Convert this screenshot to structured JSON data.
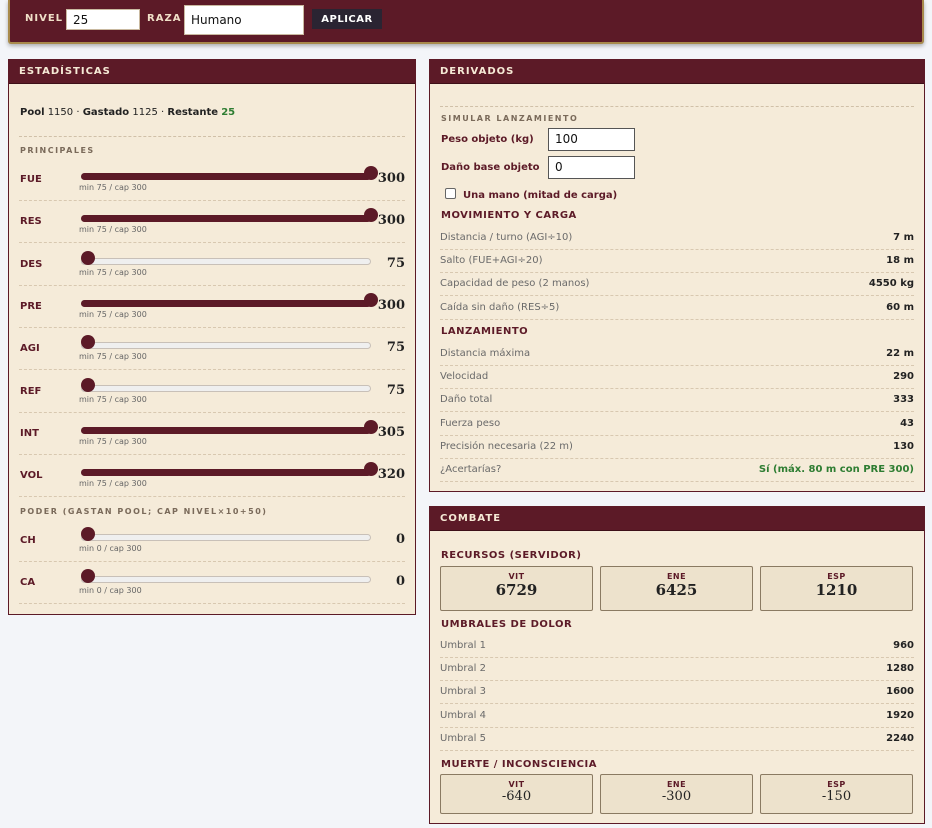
{
  "topbar": {
    "level_label": "NIVEL",
    "level_value": "25",
    "race_label": "RAZA",
    "race_value": "Humano",
    "apply_label": "APLICAR"
  },
  "stats": {
    "title": "ESTADÍSTICAS",
    "pool_label": "Pool",
    "pool_value": "1150",
    "spent_label": "Gastado",
    "spent_value": "1125",
    "remaining_label": "Restante",
    "remaining_value": "25",
    "principal_title": "PRINCIPALES",
    "principal": [
      {
        "code": "FUE",
        "range": "min 75 / cap 300",
        "value": "300",
        "level": 1.0
      },
      {
        "code": "RES",
        "range": "min 75 / cap 300",
        "value": "300",
        "level": 1.0
      },
      {
        "code": "DES",
        "range": "min 75 / cap 300",
        "value": "75",
        "level": 0.0
      },
      {
        "code": "PRE",
        "range": "min 75 / cap 300",
        "value": "300",
        "level": 1.0
      },
      {
        "code": "AGI",
        "range": "min 75 / cap 300",
        "value": "75",
        "level": 0.0
      },
      {
        "code": "REF",
        "range": "min 75 / cap 300",
        "value": "75",
        "level": 0.0
      },
      {
        "code": "INT",
        "range": "min 75 / cap 300",
        "value": "305",
        "level": 1.0
      },
      {
        "code": "VOL",
        "range": "min 75 / cap 300",
        "value": "320",
        "level": 1.0
      }
    ],
    "power_title": "PODER (GASTAN POOL; CAP NIVEL×10+50)",
    "power": [
      {
        "code": "CH",
        "range": "min 0 / cap 300",
        "value": "0",
        "level": 0.0
      },
      {
        "code": "CA",
        "range": "min 0 / cap 300",
        "value": "0",
        "level": 0.0
      }
    ]
  },
  "derived": {
    "title": "DERIVADOS",
    "simulate_title": "SIMULAR LANZAMIENTO",
    "weight_label": "Peso objeto (kg)",
    "weight_value": "100",
    "damage_label": "Daño base objeto",
    "damage_value": "0",
    "one_hand_label": "Una mano (mitad de carga)",
    "movement_title": "MOVIMIENTO Y CARGA",
    "movement": [
      {
        "k": "Distancia / turno (AGI÷10)",
        "v": "7 m"
      },
      {
        "k": "Salto (FUE+AGI÷20)",
        "v": "18 m"
      },
      {
        "k": "Capacidad de peso (2 manos)",
        "v": "4550 kg"
      },
      {
        "k": "Caída sin daño (RES÷5)",
        "v": "60 m"
      }
    ],
    "launch_title": "LANZAMIENTO",
    "launch": [
      {
        "k": "Distancia máxima",
        "v": "22 m"
      },
      {
        "k": "Velocidad",
        "v": "290"
      },
      {
        "k": "Daño total",
        "v": "333"
      },
      {
        "k": "Fuerza peso",
        "v": "43"
      },
      {
        "k": "Precisión necesaria (22 m)",
        "v": "130"
      },
      {
        "k": "¿Acertarías?",
        "v": "Sí (máx. 80 m con PRE 300)"
      }
    ]
  },
  "combat": {
    "title": "COMBATE",
    "resources_title": "RECURSOS (SERVIDOR)",
    "resources": [
      {
        "label": "VIT",
        "value": "6729"
      },
      {
        "label": "ENE",
        "value": "6425"
      },
      {
        "label": "ESP",
        "value": "1210"
      }
    ],
    "pain_title": "UMBRALES DE DOLOR",
    "pain": [
      {
        "k": "Umbral 1",
        "v": "960"
      },
      {
        "k": "Umbral 2",
        "v": "1280"
      },
      {
        "k": "Umbral 3",
        "v": "1600"
      },
      {
        "k": "Umbral 4",
        "v": "1920"
      },
      {
        "k": "Umbral 5",
        "v": "2240"
      }
    ],
    "death_title": "MUERTE / INCONSCIENCIA",
    "death": [
      {
        "label": "VIT",
        "value": "-640"
      },
      {
        "label": "ENE",
        "value": "-300"
      },
      {
        "label": "ESP",
        "value": "-150"
      }
    ]
  }
}
